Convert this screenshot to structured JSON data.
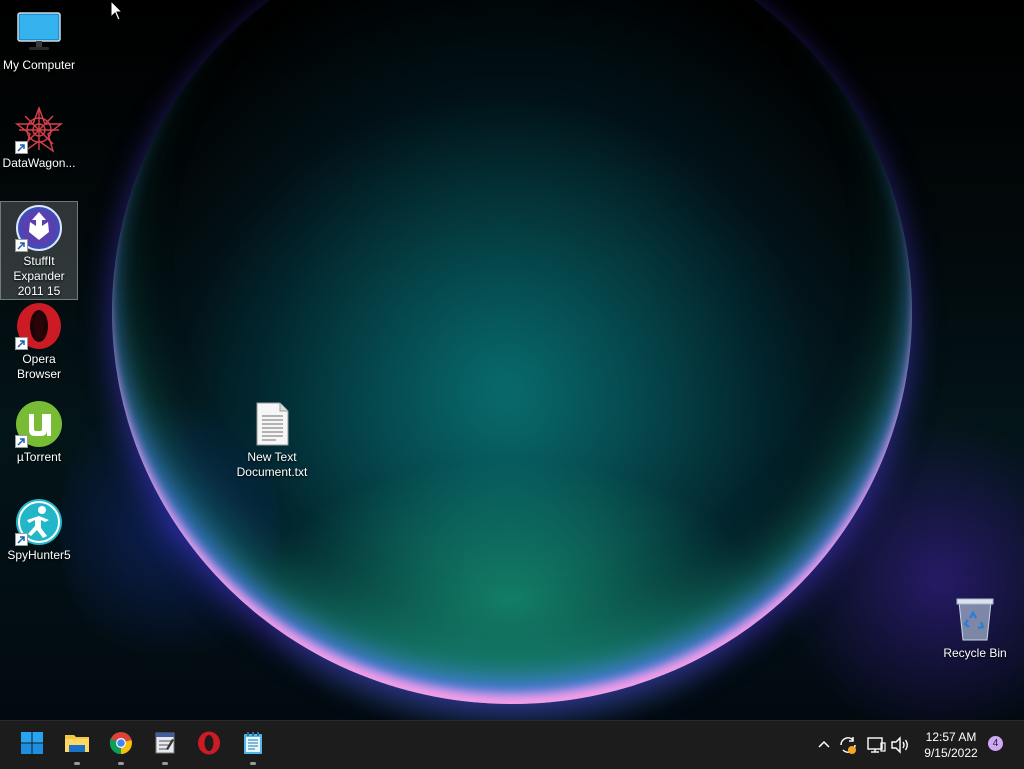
{
  "desktop": {
    "icons": [
      {
        "label": "My Computer",
        "icon": "monitor-icon"
      },
      {
        "label": "DataWagon...",
        "icon": "datawagon-icon"
      },
      {
        "label": "StuffIt Expander 2011 15",
        "icon": "stuffit-icon",
        "selected": true
      },
      {
        "label": "Opera Browser",
        "icon": "opera-icon"
      },
      {
        "label": "µTorrent",
        "icon": "utorrent-icon"
      },
      {
        "label": "SpyHunter5",
        "icon": "spyhunter-icon"
      },
      {
        "label": "New Text Document.txt",
        "icon": "text-file-icon"
      },
      {
        "label": "Recycle Bin",
        "icon": "recycle-bin-icon"
      }
    ]
  },
  "taskbar": {
    "apps": [
      {
        "name": "Start",
        "icon": "windows-start-icon"
      },
      {
        "name": "File Explorer",
        "icon": "folder-icon",
        "running": true
      },
      {
        "name": "Google Chrome",
        "icon": "chrome-icon",
        "running": true
      },
      {
        "name": "Text Editor",
        "icon": "editor-icon",
        "running": true
      },
      {
        "name": "Opera",
        "icon": "opera-icon"
      },
      {
        "name": "Notepad",
        "icon": "notepad-icon",
        "running": true
      }
    ],
    "tray": {
      "icons": [
        "chevron-up-icon",
        "sync-icon",
        "network-icon",
        "volume-icon"
      ],
      "time": "12:57 AM",
      "date": "9/15/2022",
      "notification_count": "4"
    }
  },
  "colors": {
    "taskbar_bg": "#1c1c1c",
    "accent": "#0078d4",
    "badge": "#cfa8f3"
  }
}
